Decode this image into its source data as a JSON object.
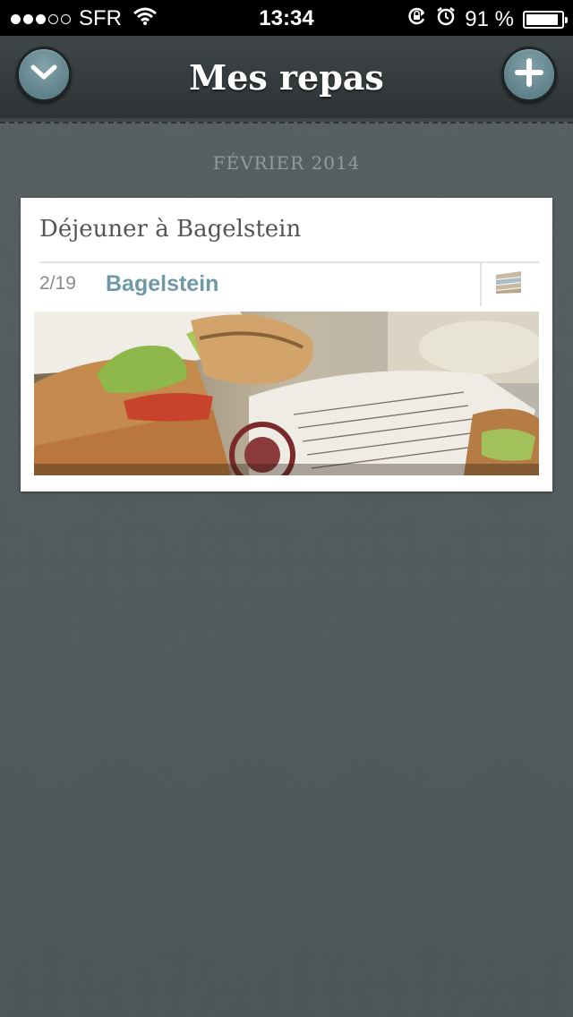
{
  "status_bar": {
    "carrier": "SFR",
    "time": "13:34",
    "battery": "91 %",
    "battery_level": 0.91,
    "signal_icon": "signal-dots-icon",
    "wifi_icon": "wifi-icon",
    "rotation_lock_icon": "rotation-lock-icon",
    "alarm_icon": "alarm-icon"
  },
  "nav": {
    "title": "Mes repas",
    "left_icon": "chevron-down-icon",
    "right_icon": "plus-icon"
  },
  "section": {
    "header": "FÉVRIER 2014"
  },
  "meals": [
    {
      "title": "Déjeuner à Bagelstein",
      "date": "2/19",
      "place": "Bagelstein",
      "type_icon": "sandwich-icon",
      "photo": "sandwich-photo"
    }
  ],
  "colors": {
    "accent": "#6e9aa8",
    "button": "#6f919a",
    "background": "#4f5759",
    "nav": "#2e3436"
  }
}
